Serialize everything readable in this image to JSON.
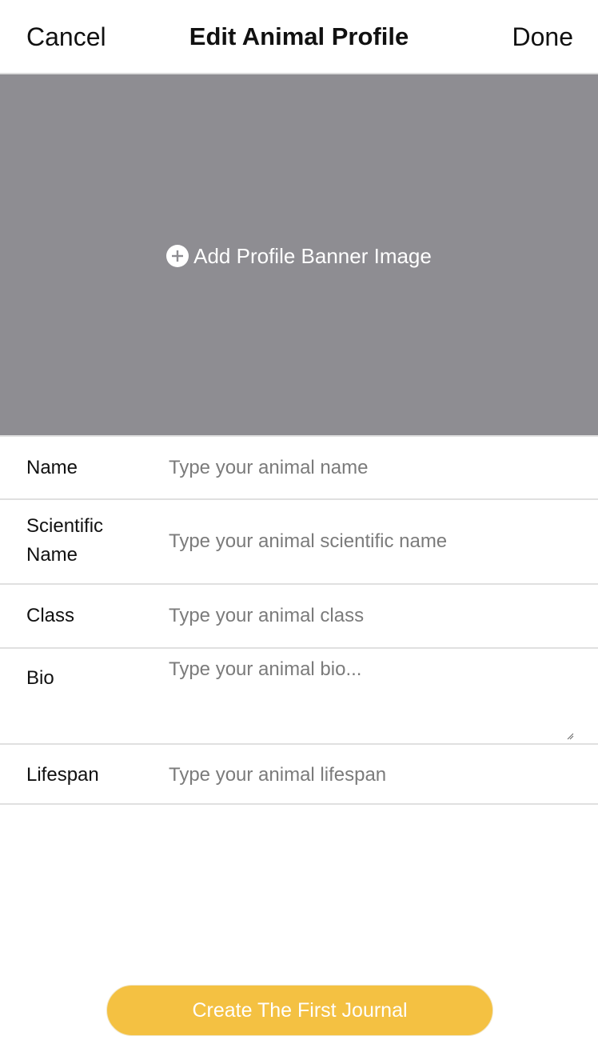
{
  "header": {
    "cancel_label": "Cancel",
    "title": "Edit Animal Profile",
    "done_label": "Done"
  },
  "banner": {
    "icon": "plus-circle-icon",
    "label": "Add Profile Banner Image",
    "background_color": "#8e8d92"
  },
  "form": {
    "name": {
      "label": "Name",
      "value": "",
      "placeholder": "Type your animal name"
    },
    "scientific_name": {
      "label_line1": "Scientific",
      "label_line2": "Name",
      "value": "",
      "placeholder": "Type your animal scientific name"
    },
    "class": {
      "label": "Class",
      "value": "",
      "placeholder": "Type your animal class"
    },
    "bio": {
      "label": "Bio",
      "value": "",
      "placeholder": "Type your animal bio..."
    },
    "lifespan": {
      "label": "Lifespan",
      "value": "",
      "placeholder": "Type your animal lifespan"
    }
  },
  "cta": {
    "label": "Create The First Journal",
    "color": "#f4c142"
  }
}
